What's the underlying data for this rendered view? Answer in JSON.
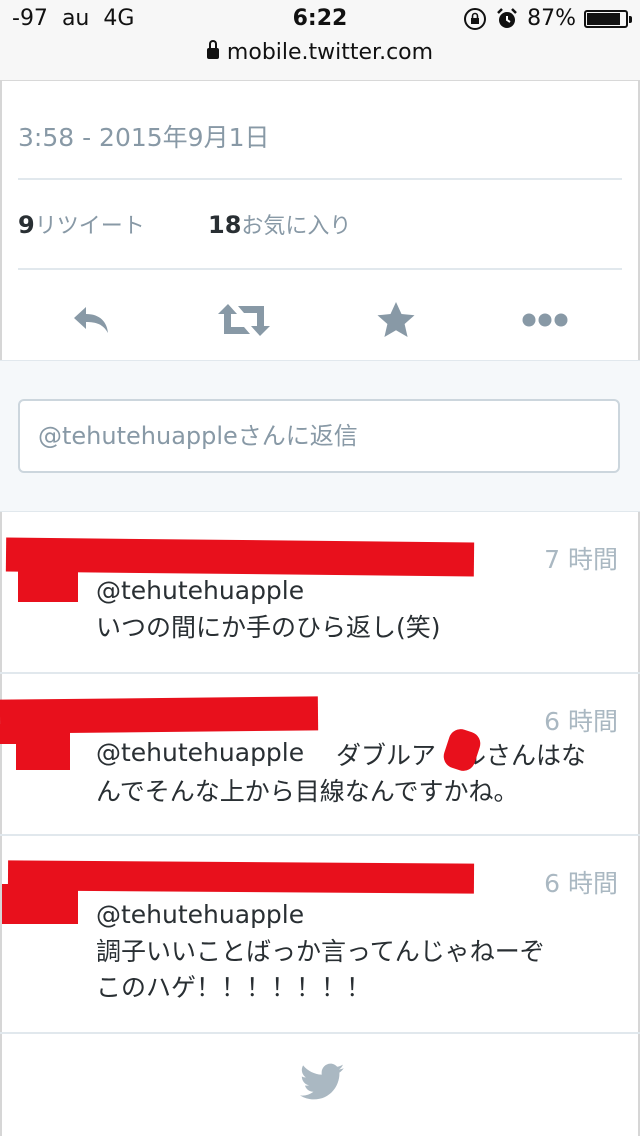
{
  "status_bar": {
    "signal": "-97",
    "carrier": "au",
    "network": "4G",
    "time": "6:22",
    "battery_percent": "87%",
    "battery_level": 0.87,
    "url": "mobile.twitter.com"
  },
  "tweet_detail": {
    "timestamp": "3:58 - 2015年9月1日",
    "retweet_count": "9",
    "retweet_label": "リツイート",
    "favorite_count": "18",
    "favorite_label": "お気に入り"
  },
  "actions": {
    "icons": [
      "reply-icon",
      "retweet-icon",
      "favorite-star-icon",
      "more-icon"
    ]
  },
  "reply_box": {
    "placeholder": "@tehutehuappleさんに返信"
  },
  "replies": [
    {
      "time": "7 時間",
      "handle": "@tehutehuapple",
      "text": "いつの間にか手のひら返し(笑)"
    },
    {
      "time": "6 時間",
      "handle": "@tehutehuapple",
      "text_line1": "ダブルア　ルさんはな",
      "text_line2": "んでそんな上から目線なんですかね。"
    },
    {
      "time": "6 時間",
      "handle": "@tehutehuapple",
      "text_line1": "調子いいことばっか言ってんじゃねーぞ",
      "text_line2": "このハゲ！！！！！！！"
    }
  ],
  "colors": {
    "accent_gray": "#8899a6",
    "redaction": "#e8101c",
    "twitter_bird": "#aab8c2"
  }
}
